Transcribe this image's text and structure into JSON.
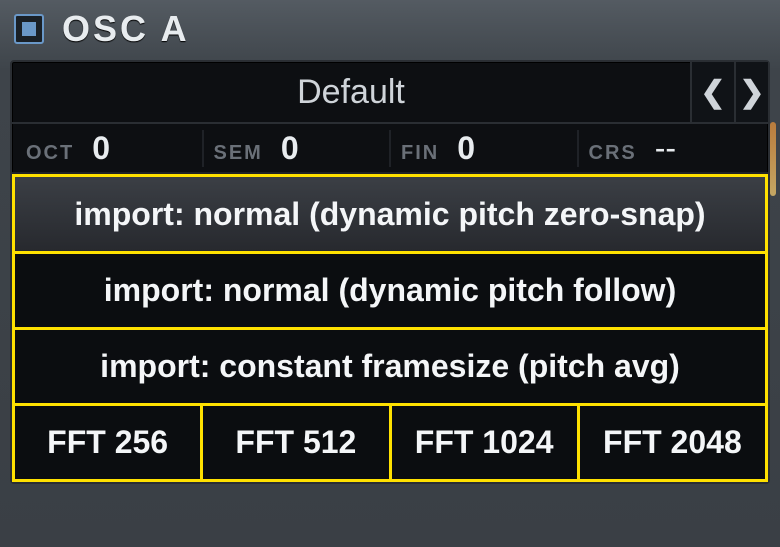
{
  "title": "OSC  A",
  "preset": {
    "name": "Default"
  },
  "coarse": {
    "oct": {
      "label": "OCT",
      "value": "0"
    },
    "sem": {
      "label": "SEM",
      "value": "0"
    },
    "fin": {
      "label": "FIN",
      "value": "0"
    },
    "crs": {
      "label": "CRS",
      "value": "--"
    }
  },
  "import_options": [
    "import: normal (dynamic pitch zero-snap)",
    "import: normal (dynamic pitch follow)",
    "import: constant framesize (pitch avg)"
  ],
  "fft_options": [
    "FFT 256",
    "FFT 512",
    "FFT 1024",
    "FFT 2048"
  ]
}
